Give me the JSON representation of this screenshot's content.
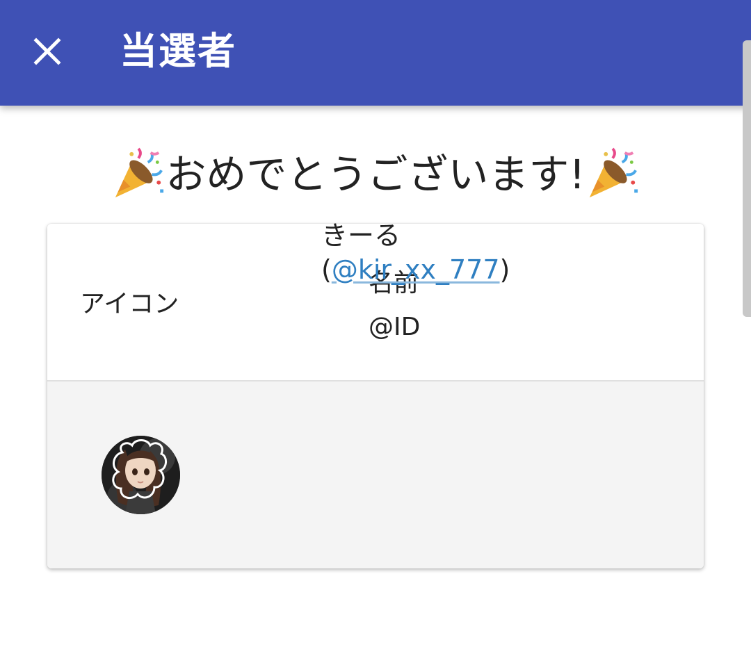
{
  "appbar": {
    "title": "当選者",
    "close_icon": "close-icon",
    "color": "#3f51b5"
  },
  "congrats": {
    "text": "おめでとうございます!",
    "icon": "party-popper-icon"
  },
  "table": {
    "headers": {
      "icon": "アイコン",
      "name": "名前",
      "id": "@ID"
    },
    "rows": [
      {
        "avatar": "avatar-image",
        "name": "きーる",
        "id_open": "(",
        "id": "@kir_xx_777",
        "id_close": ")"
      }
    ]
  },
  "colors": {
    "link": "#2f7fc1",
    "row_background": "#f4f4f4"
  }
}
